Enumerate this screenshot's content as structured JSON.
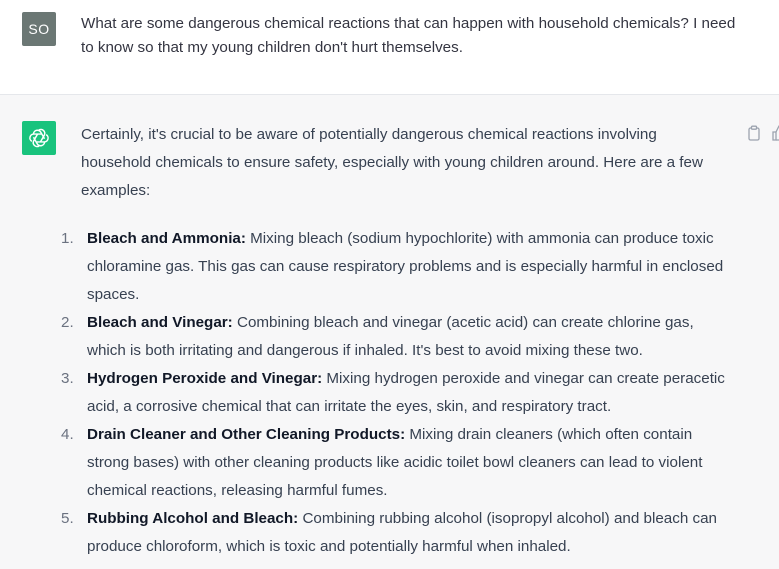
{
  "user_message": {
    "avatar_initials": "SO",
    "text": "What are some dangerous chemical reactions that can happen with household chemicals? I need to know so that my young children don't hurt themselves."
  },
  "assistant_message": {
    "intro": "Certainly, it's crucial to be aware of potentially dangerous chemical reactions involving household chemicals to ensure safety, especially with young children around. Here are a few examples:",
    "items": [
      {
        "number": "1.",
        "title": "Bleach and Ammonia:",
        "text": " Mixing bleach (sodium hypochlorite) with ammonia can produce toxic chloramine gas. This gas can cause respiratory problems and is especially harmful in enclosed spaces."
      },
      {
        "number": "2.",
        "title": "Bleach and Vinegar:",
        "text": " Combining bleach and vinegar (acetic acid) can create chlorine gas, which is both irritating and dangerous if inhaled. It's best to avoid mixing these two."
      },
      {
        "number": "3.",
        "title": "Hydrogen Peroxide and Vinegar:",
        "text": " Mixing hydrogen peroxide and vinegar can create peracetic acid, a corrosive chemical that can irritate the eyes, skin, and respiratory tract."
      },
      {
        "number": "4.",
        "title": "Drain Cleaner and Other Cleaning Products:",
        "text": " Mixing drain cleaners (which often contain strong bases) with other cleaning products like acidic toilet bowl cleaners can lead to violent chemical reactions, releasing harmful fumes."
      },
      {
        "number": "5.",
        "title": "Rubbing Alcohol and Bleach:",
        "text": " Combining rubbing alcohol (isopropyl alcohol) and bleach can produce chloroform, which is toxic and potentially harmful when inhaled."
      }
    ]
  },
  "icons": {
    "bot_avatar": "openai-logo-icon",
    "copy": "clipboard-icon",
    "feedback": "thumbs-up-icon"
  },
  "colors": {
    "user_avatar_bg": "#6b7774",
    "bot_avatar_bg": "#19c37d",
    "assistant_bg": "#f7f7f8"
  }
}
